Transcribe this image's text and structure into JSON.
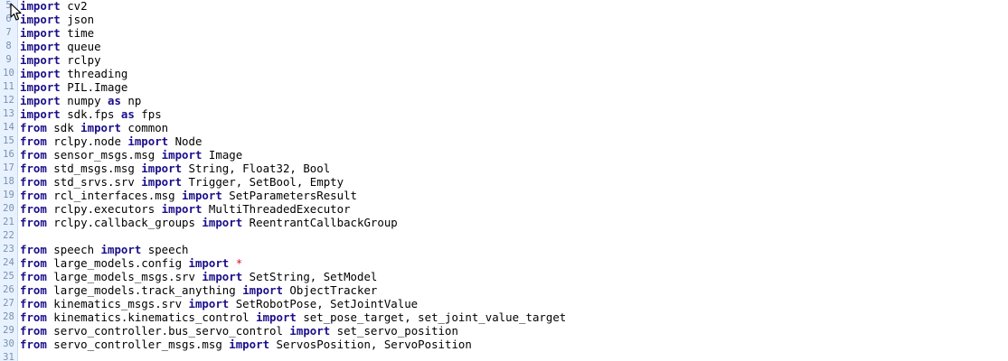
{
  "lines": [
    {
      "num": "5",
      "tokens": [
        {
          "k": "kw",
          "t": "import"
        },
        {
          "k": "p",
          "t": " cv2"
        }
      ]
    },
    {
      "num": "6",
      "tokens": [
        {
          "k": "kw",
          "t": "import"
        },
        {
          "k": "p",
          "t": " json"
        }
      ]
    },
    {
      "num": "7",
      "tokens": [
        {
          "k": "kw",
          "t": "import"
        },
        {
          "k": "p",
          "t": " time"
        }
      ]
    },
    {
      "num": "8",
      "tokens": [
        {
          "k": "kw",
          "t": "import"
        },
        {
          "k": "p",
          "t": " queue"
        }
      ]
    },
    {
      "num": "9",
      "tokens": [
        {
          "k": "kw",
          "t": "import"
        },
        {
          "k": "p",
          "t": " rclpy"
        }
      ]
    },
    {
      "num": "10",
      "tokens": [
        {
          "k": "kw",
          "t": "import"
        },
        {
          "k": "p",
          "t": " threading"
        }
      ]
    },
    {
      "num": "11",
      "tokens": [
        {
          "k": "kw",
          "t": "import"
        },
        {
          "k": "p",
          "t": " PIL.Image"
        }
      ]
    },
    {
      "num": "12",
      "tokens": [
        {
          "k": "kw",
          "t": "import"
        },
        {
          "k": "p",
          "t": " numpy "
        },
        {
          "k": "kw",
          "t": "as"
        },
        {
          "k": "p",
          "t": " np"
        }
      ]
    },
    {
      "num": "13",
      "tokens": [
        {
          "k": "kw",
          "t": "import"
        },
        {
          "k": "p",
          "t": " sdk.fps "
        },
        {
          "k": "kw",
          "t": "as"
        },
        {
          "k": "p",
          "t": " fps"
        }
      ]
    },
    {
      "num": "14",
      "tokens": [
        {
          "k": "kw",
          "t": "from"
        },
        {
          "k": "p",
          "t": " sdk "
        },
        {
          "k": "kw",
          "t": "import"
        },
        {
          "k": "p",
          "t": " common"
        }
      ]
    },
    {
      "num": "15",
      "tokens": [
        {
          "k": "kw",
          "t": "from"
        },
        {
          "k": "p",
          "t": " rclpy.node "
        },
        {
          "k": "kw",
          "t": "import"
        },
        {
          "k": "p",
          "t": " Node"
        }
      ]
    },
    {
      "num": "16",
      "tokens": [
        {
          "k": "kw",
          "t": "from"
        },
        {
          "k": "p",
          "t": " sensor_msgs.msg "
        },
        {
          "k": "kw",
          "t": "import"
        },
        {
          "k": "p",
          "t": " Image"
        }
      ]
    },
    {
      "num": "17",
      "tokens": [
        {
          "k": "kw",
          "t": "from"
        },
        {
          "k": "p",
          "t": " std_msgs.msg "
        },
        {
          "k": "kw",
          "t": "import"
        },
        {
          "k": "p",
          "t": " String, Float32, Bool"
        }
      ]
    },
    {
      "num": "18",
      "tokens": [
        {
          "k": "kw",
          "t": "from"
        },
        {
          "k": "p",
          "t": " std_srvs.srv "
        },
        {
          "k": "kw",
          "t": "import"
        },
        {
          "k": "p",
          "t": " Trigger, SetBool, Empty"
        }
      ]
    },
    {
      "num": "19",
      "tokens": [
        {
          "k": "kw",
          "t": "from"
        },
        {
          "k": "p",
          "t": " rcl_interfaces.msg "
        },
        {
          "k": "kw",
          "t": "import"
        },
        {
          "k": "p",
          "t": " SetParametersResult"
        }
      ]
    },
    {
      "num": "20",
      "tokens": [
        {
          "k": "kw",
          "t": "from"
        },
        {
          "k": "p",
          "t": " rclpy.executors "
        },
        {
          "k": "kw",
          "t": "import"
        },
        {
          "k": "p",
          "t": " MultiThreadedExecutor"
        }
      ]
    },
    {
      "num": "21",
      "tokens": [
        {
          "k": "kw",
          "t": "from"
        },
        {
          "k": "p",
          "t": " rclpy.callback_groups "
        },
        {
          "k": "kw",
          "t": "import"
        },
        {
          "k": "p",
          "t": " ReentrantCallbackGroup"
        }
      ]
    },
    {
      "num": "22",
      "tokens": []
    },
    {
      "num": "23",
      "tokens": [
        {
          "k": "kw",
          "t": "from"
        },
        {
          "k": "p",
          "t": " speech "
        },
        {
          "k": "kw",
          "t": "import"
        },
        {
          "k": "p",
          "t": " speech"
        }
      ]
    },
    {
      "num": "24",
      "tokens": [
        {
          "k": "kw",
          "t": "from"
        },
        {
          "k": "p",
          "t": " large_models.config "
        },
        {
          "k": "kw",
          "t": "import"
        },
        {
          "k": "p",
          "t": " "
        },
        {
          "k": "op",
          "t": "*"
        }
      ]
    },
    {
      "num": "25",
      "tokens": [
        {
          "k": "kw",
          "t": "from"
        },
        {
          "k": "p",
          "t": " large_models_msgs.srv "
        },
        {
          "k": "kw",
          "t": "import"
        },
        {
          "k": "p",
          "t": " SetString, SetModel"
        }
      ]
    },
    {
      "num": "26",
      "tokens": [
        {
          "k": "kw",
          "t": "from"
        },
        {
          "k": "p",
          "t": " large_models.track_anything "
        },
        {
          "k": "kw",
          "t": "import"
        },
        {
          "k": "p",
          "t": " ObjectTracker"
        }
      ]
    },
    {
      "num": "27",
      "tokens": [
        {
          "k": "kw",
          "t": "from"
        },
        {
          "k": "p",
          "t": " kinematics_msgs.srv "
        },
        {
          "k": "kw",
          "t": "import"
        },
        {
          "k": "p",
          "t": " SetRobotPose, SetJointValue"
        }
      ]
    },
    {
      "num": "28",
      "tokens": [
        {
          "k": "kw",
          "t": "from"
        },
        {
          "k": "p",
          "t": " kinematics.kinematics_control "
        },
        {
          "k": "kw",
          "t": "import"
        },
        {
          "k": "p",
          "t": " set_pose_target, set_joint_value_target"
        }
      ]
    },
    {
      "num": "29",
      "tokens": [
        {
          "k": "kw",
          "t": "from"
        },
        {
          "k": "p",
          "t": " servo_controller.bus_servo_control "
        },
        {
          "k": "kw",
          "t": "import"
        },
        {
          "k": "p",
          "t": " set_servo_position"
        }
      ]
    },
    {
      "num": "30",
      "tokens": [
        {
          "k": "kw",
          "t": "from"
        },
        {
          "k": "p",
          "t": " servo_controller_msgs.msg "
        },
        {
          "k": "kw",
          "t": "import"
        },
        {
          "k": "p",
          "t": " ServosPosition, ServoPosition"
        }
      ]
    },
    {
      "num": "31",
      "tokens": []
    }
  ],
  "icons": {
    "cursor": "mouse-pointer-icon"
  }
}
